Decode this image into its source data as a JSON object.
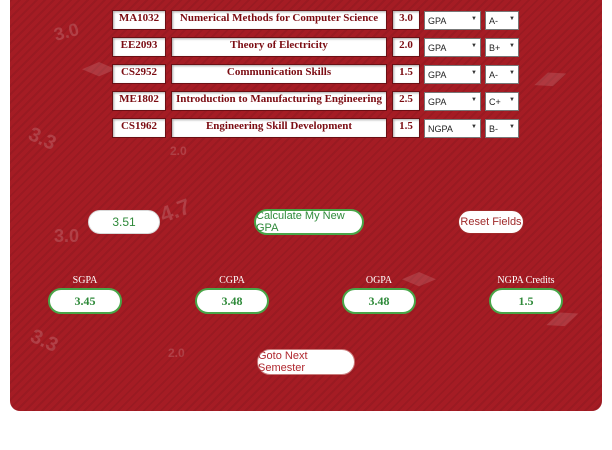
{
  "courses": [
    {
      "code": "MA1032",
      "name": "Numerical Methods for Computer Science",
      "credits": "3.0",
      "type": "GPA",
      "grade": "A-"
    },
    {
      "code": "EE2093",
      "name": "Theory of Electricity",
      "credits": "2.0",
      "type": "GPA",
      "grade": "B+"
    },
    {
      "code": "CS2952",
      "name": "Communication Skills",
      "credits": "1.5",
      "type": "GPA",
      "grade": "A-"
    },
    {
      "code": "ME1802",
      "name": "Introduction to Manufacturing Engineering",
      "credits": "2.5",
      "type": "GPA",
      "grade": "C+"
    },
    {
      "code": "CS1962",
      "name": "Engineering Skill Development",
      "credits": "1.5",
      "type": "NGPA",
      "grade": "B-"
    }
  ],
  "current_gpa_input": "3.51",
  "buttons": {
    "calculate": "Calculate My New GPA",
    "reset": "Reset Fields",
    "next_semester": "Goto Next Semester"
  },
  "results": {
    "sgpa": {
      "label": "SGPA",
      "value": "3.45"
    },
    "cgpa": {
      "label": "CGPA",
      "value": "3.48"
    },
    "ogpa": {
      "label": "OGPA",
      "value": "3.48"
    },
    "ngpa_credits": {
      "label": "NGPA Credits",
      "value": "1.5"
    }
  },
  "watermarks": [
    "3.0",
    "3.3",
    "2.0",
    "4.7",
    "3.0",
    "3.3",
    "2.0"
  ],
  "colors": {
    "panel_bg": "#a51c24",
    "text_dark_red": "#7b0c12",
    "green_border": "#49a548",
    "green_text": "#2f8a3a",
    "reset_border": "#a02a2a",
    "next_text": "#b0282f"
  },
  "icons": {
    "select_arrow": "caret-down-icon",
    "watermark": "graduation-cap-icon"
  }
}
